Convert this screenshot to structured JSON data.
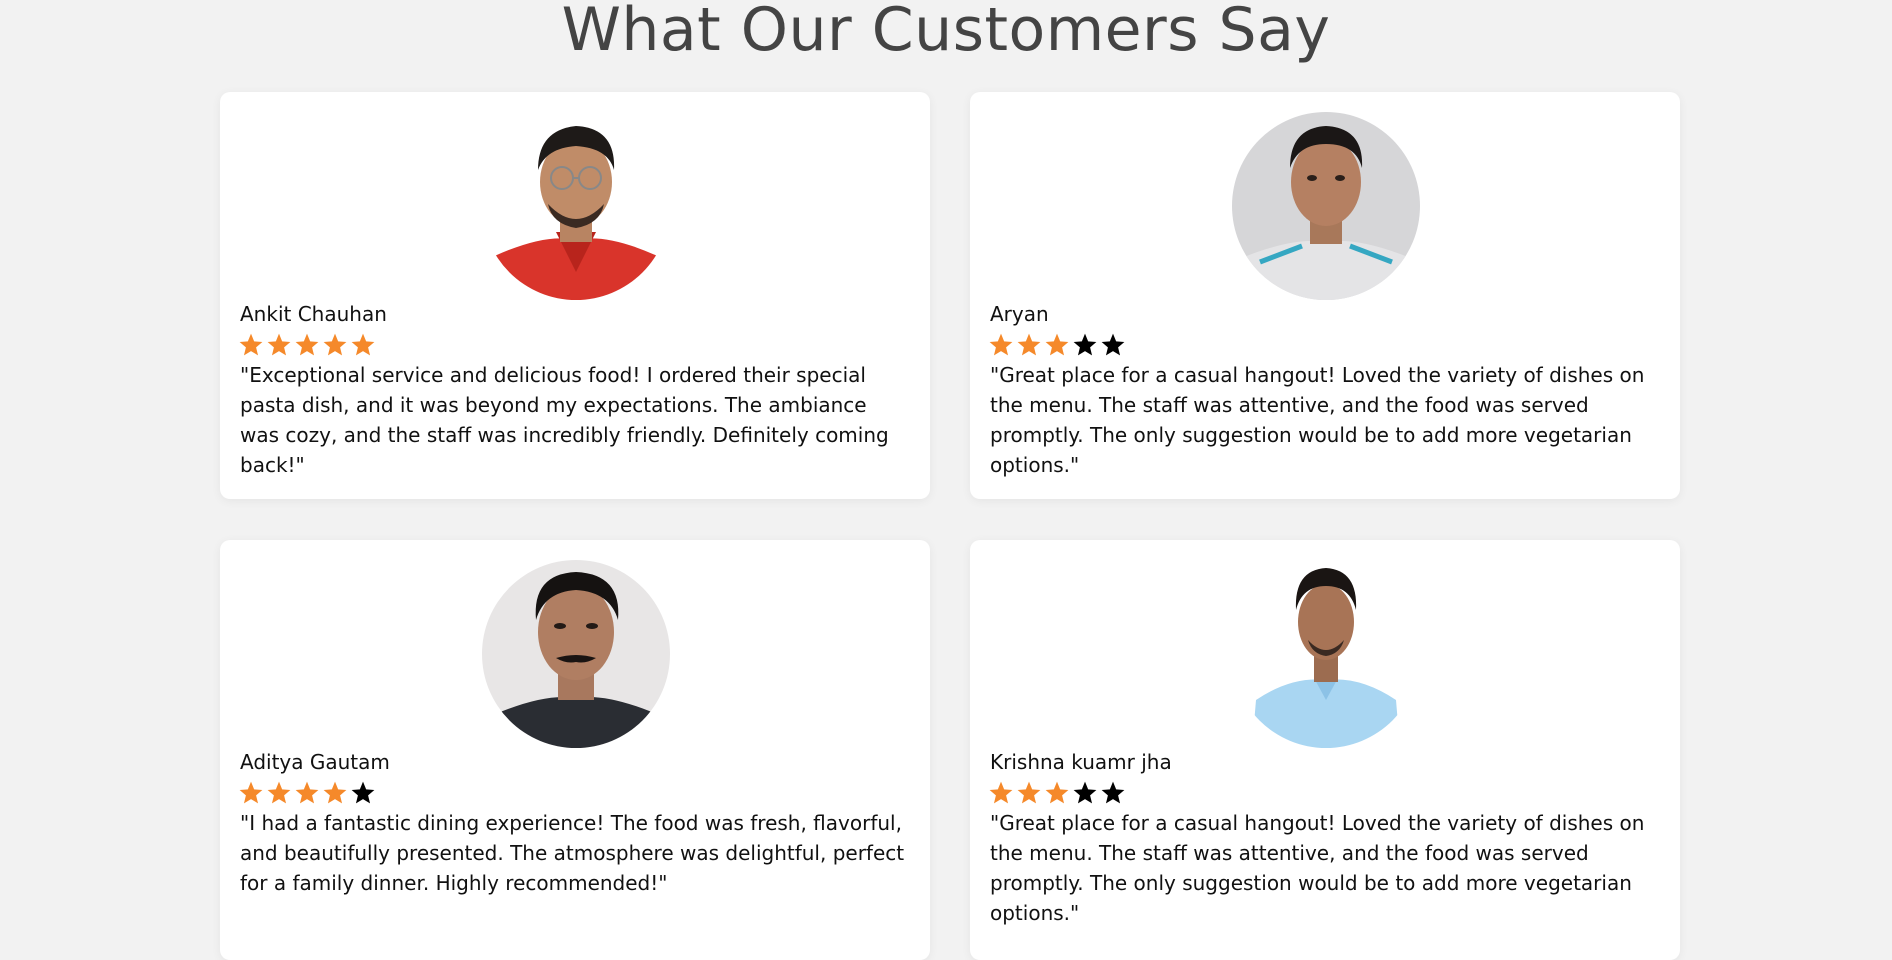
{
  "page": {
    "title": "What Our Customers Say"
  },
  "colors": {
    "star_filled": "#f5892a",
    "star_empty": "#000000",
    "card_bg": "#ffffff",
    "page_bg": "#f2f2f2"
  },
  "reviews": [
    {
      "name": "Ankit Chauhan",
      "rating": 5,
      "max_rating": 5,
      "text": "\"Exceptional service and delicious food! I ordered their special pasta dish, and it was beyond my expectations. The ambiance was cozy, and the staff was incredibly friendly. Definitely coming back!\""
    },
    {
      "name": "Aryan",
      "rating": 3,
      "max_rating": 5,
      "text": "\"Great place for a casual hangout! Loved the variety of dishes on the menu. The staff was attentive, and the food was served promptly. The only suggestion would be to add more vegetarian options.\""
    },
    {
      "name": "Aditya Gautam",
      "rating": 4,
      "max_rating": 5,
      "text": "\"I had a fantastic dining experience! The food was fresh, flavorful, and beautifully presented. The atmosphere was delightful, perfect for a family dinner. Highly recommended!\""
    },
    {
      "name": "Krishna kuamr jha",
      "rating": 3,
      "max_rating": 5,
      "text": "\"Great place for a casual hangout! Loved the variety of dishes on the menu. The staff was attentive, and the food was served promptly. The only suggestion would be to add more vegetarian options.\""
    }
  ]
}
